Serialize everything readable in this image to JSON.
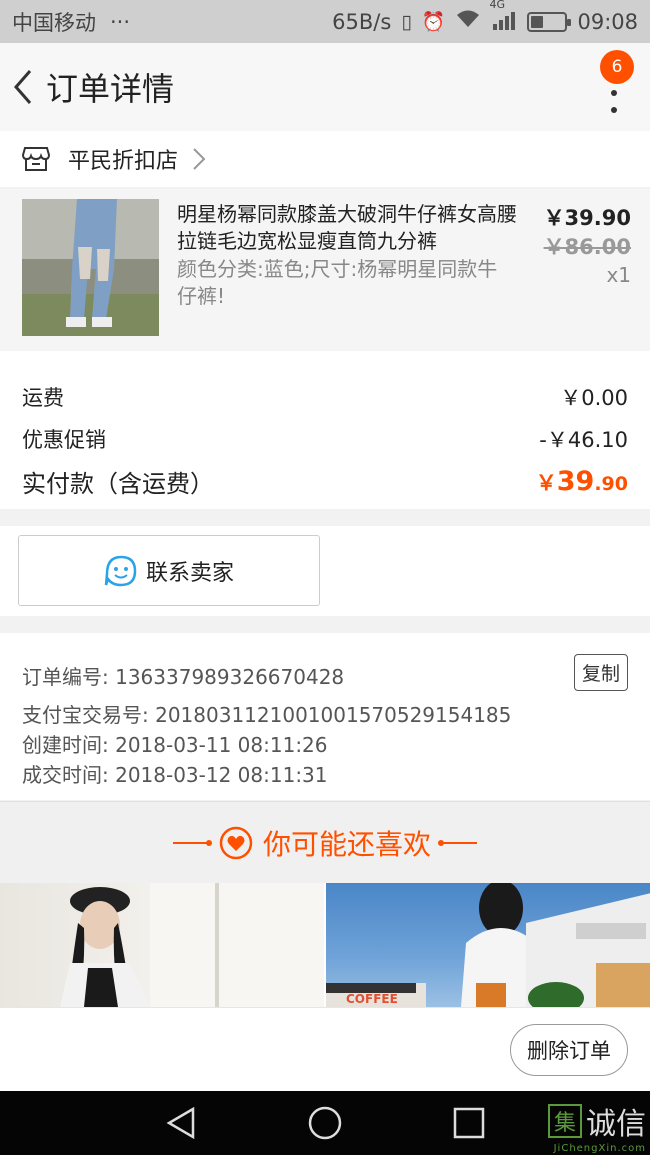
{
  "status_bar": {
    "carrier": "中国移动",
    "dots": "···",
    "speed": "65B/s",
    "network": "4G",
    "time": "09:08"
  },
  "nav": {
    "title": "订单详情",
    "badge": "6"
  },
  "store": {
    "name": "平民折扣店"
  },
  "product": {
    "title": "明星杨幂同款膝盖大破洞牛仔裤女高腰拉链毛边宽松显瘦直筒九分裤",
    "sku": "颜色分类:蓝色;尺寸:杨幂明星同款牛仔裤!",
    "price": "￥39.90",
    "original_price": "￥86.00",
    "quantity": "x1"
  },
  "fees": {
    "shipping_label": "运费",
    "shipping_value": "￥0.00",
    "discount_label": "优惠促销",
    "discount_value": "-￥46.10",
    "total_label": "实付款（含运费）",
    "total_symbol": "￥",
    "total_int": "39",
    "total_dec": ".90"
  },
  "contact": {
    "label": "联系卖家"
  },
  "order_info": {
    "order_no": "订单编号: 136337989326670428",
    "alipay_no": "支付宝交易号: 2018031121001001570529154185",
    "created": "创建时间: 2018-03-11 08:11:26",
    "completed": "成交时间: 2018-03-12 08:11:31",
    "copy_label": "复制"
  },
  "recommend": {
    "title": "你可能还喜欢",
    "coffee_sign": "COFFEE"
  },
  "actions": {
    "delete_label": "删除订单"
  },
  "watermark": {
    "text": "诚信",
    "box_char": "集",
    "sub": "JiChengXin.com"
  },
  "colors": {
    "accent": "#ff5000",
    "status_bar_bg": "#cfcfcf",
    "nav_bar_bg": "#050505"
  }
}
